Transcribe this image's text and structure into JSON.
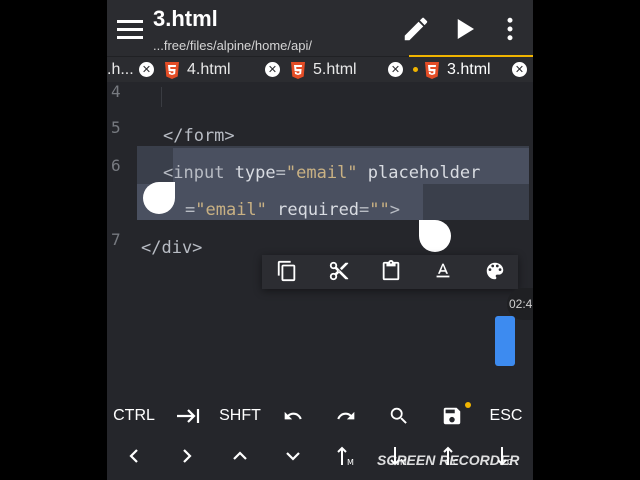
{
  "header": {
    "file_name": "3.html",
    "path": "...free/files/alpine/home/api/"
  },
  "tabs": [
    {
      "label": ".h...",
      "icon": "html5-icon",
      "active": false
    },
    {
      "label": "4.html",
      "icon": "html5-icon",
      "active": false
    },
    {
      "label": "5.html",
      "icon": "html5-icon",
      "active": false
    },
    {
      "label": "3.html",
      "icon": "html5-icon",
      "active": true,
      "unsaved": true
    }
  ],
  "editor": {
    "line_numbers": [
      "4",
      "5",
      "6",
      "7"
    ],
    "lines": {
      "l5_tag": "</form>",
      "l6_open": "<",
      "l6_tag": "input",
      "l6_attr1": "type",
      "l6_eq1": "=",
      "l6_val1": "\"email\"",
      "l6_attr2": "placeholder",
      "l6b_eq": "=",
      "l6b_val": "\"email\"",
      "l6b_attr3": "required",
      "l6b_eq3": "=",
      "l6b_val3": "\"\"",
      "l6b_close": ">",
      "l7_tag": "</div>"
    }
  },
  "context_menu": [
    "copy-icon",
    "cut-icon",
    "paste-icon",
    "text-format-icon",
    "palette-icon"
  ],
  "clock_text": "02:4",
  "keyboard": {
    "row1": {
      "ctrl": "CTRL",
      "shift": "SHFT",
      "esc": "ESC"
    },
    "row1_icons": [
      "tab-icon",
      "undo-icon",
      "redo-icon",
      "search-icon",
      "save-icon"
    ],
    "row2_icons": [
      "arrow-left-icon",
      "arrow-right-icon",
      "arrow-up-icon",
      "arrow-down-icon",
      "page-up-icon",
      "page-down-icon",
      "home-icon",
      "end-icon"
    ]
  },
  "watermark": "SCREEN RECORDER",
  "colors": {
    "background": "#25262b",
    "accent": "#f0b400",
    "html5": "#e44d26",
    "scroll_thumb": "#3d8bf0"
  }
}
